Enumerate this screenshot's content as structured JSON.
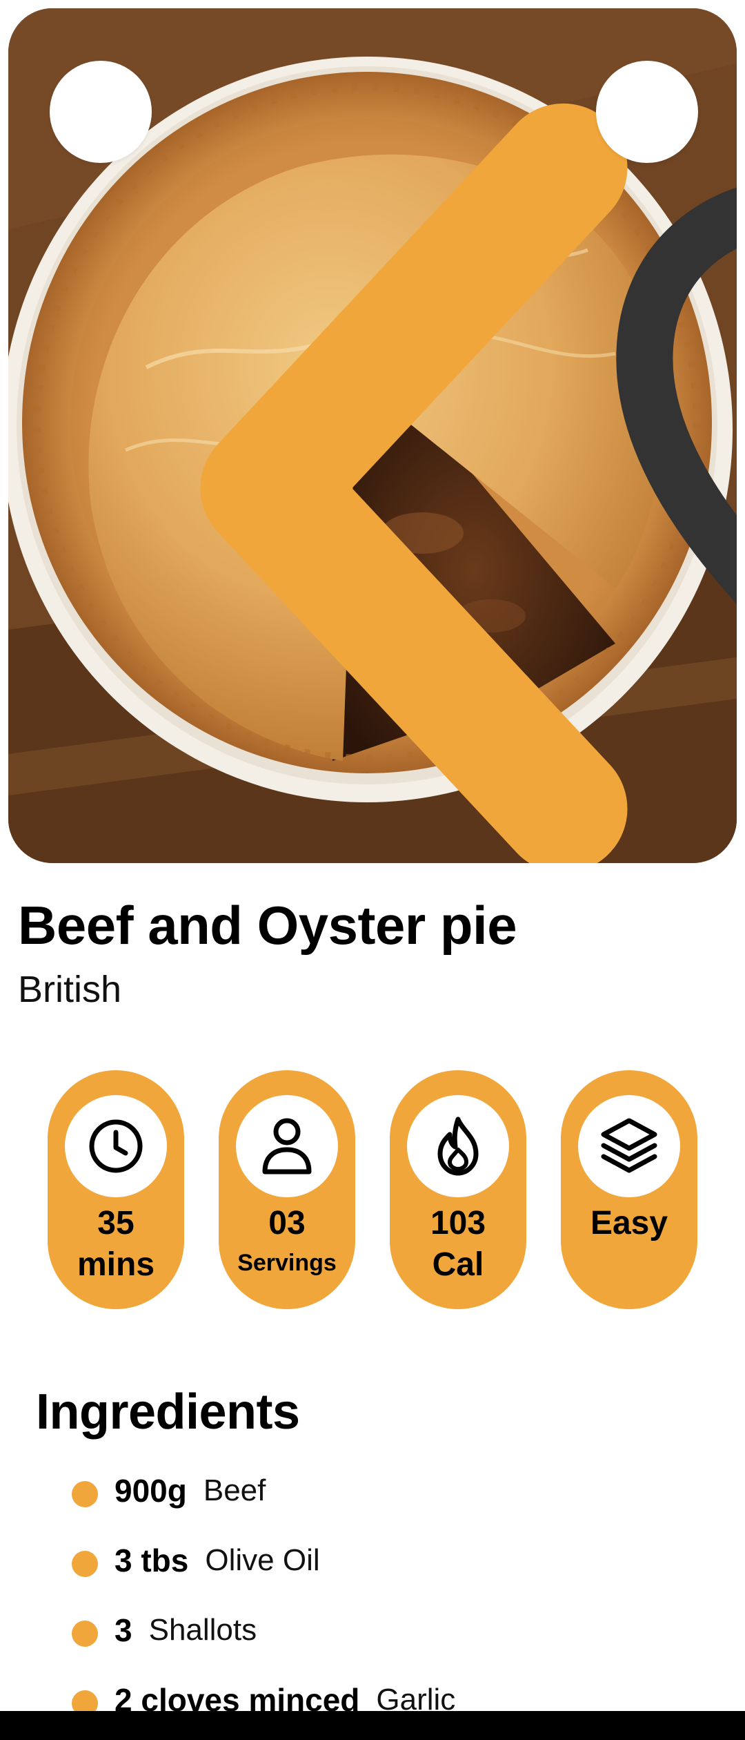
{
  "recipe": {
    "title": "Beef and Oyster pie",
    "cuisine": "British"
  },
  "hero": {
    "image": "photo of a baked beef and oyster pie in a white dish with a slice removed, on a wooden board",
    "back_icon": "chevron-left-icon",
    "favorite_icon": "heart-outline-icon"
  },
  "stats": [
    {
      "icon": "clock-icon",
      "value": "35",
      "unit": "mins"
    },
    {
      "icon": "person-icon",
      "value": "03",
      "unit": "Servings"
    },
    {
      "icon": "flame-icon",
      "value": "103",
      "unit": "Cal"
    },
    {
      "icon": "layers-icon",
      "value": "Easy",
      "unit": ""
    }
  ],
  "ingredients": {
    "title": "Ingredients",
    "items": [
      {
        "qty": "900g",
        "name": "Beef"
      },
      {
        "qty": "3 tbs",
        "name": "Olive Oil"
      },
      {
        "qty": "3",
        "name": "Shallots"
      },
      {
        "qty": "2 cloves minced",
        "name": "Garlic"
      }
    ]
  },
  "colors": {
    "accent": "#f0a63a",
    "text": "#000000",
    "background": "#ffffff"
  }
}
